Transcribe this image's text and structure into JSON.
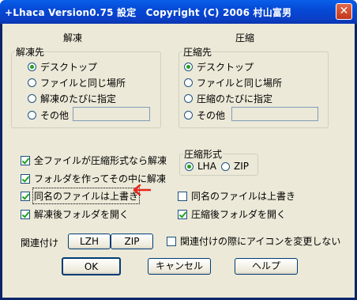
{
  "window": {
    "title": "+Lhaca Version0.75 設定　Copyright (C) 2006 村山富男",
    "close_glyph": "✕"
  },
  "extract": {
    "section_title": "解凍",
    "dest_group_label": "解凍先",
    "options": [
      "デスクトップ",
      "ファイルと同じ場所",
      "解凍のたびに指定",
      "その他"
    ],
    "selected_index": 0,
    "other_value": "",
    "checkboxes": [
      {
        "label": "全ファイルが圧縮形式なら解凍",
        "checked": true
      },
      {
        "label": "フォルダを作ってその中に解凍",
        "checked": true
      },
      {
        "label": "同名のファイルは上書き",
        "checked": true
      },
      {
        "label": "解凍後フォルダを開く",
        "checked": true
      }
    ]
  },
  "compress": {
    "section_title": "圧縮",
    "dest_group_label": "圧縮先",
    "options": [
      "デスクトップ",
      "ファイルと同じ場所",
      "圧縮のたびに指定",
      "その他"
    ],
    "selected_index": 0,
    "other_value": "",
    "format_group_label": "圧縮形式",
    "formats": [
      "LHA",
      "ZIP"
    ],
    "format_selected_index": 0,
    "checkboxes": [
      {
        "label": "同名のファイルは上書き",
        "checked": false
      },
      {
        "label": "圧縮後フォルダを開く",
        "checked": true
      }
    ]
  },
  "association": {
    "label": "関連付け",
    "buttons": [
      "LZH",
      "ZIP"
    ],
    "no_icon_change": {
      "label": "関連付けの際にアイコンを変更しない",
      "checked": false
    }
  },
  "footer": {
    "ok": "OK",
    "cancel": "キャンセル",
    "help": "ヘルプ"
  },
  "annotation": {
    "arrow_color": "#e8261c",
    "arrow_icon": "left-arrow-icon"
  }
}
